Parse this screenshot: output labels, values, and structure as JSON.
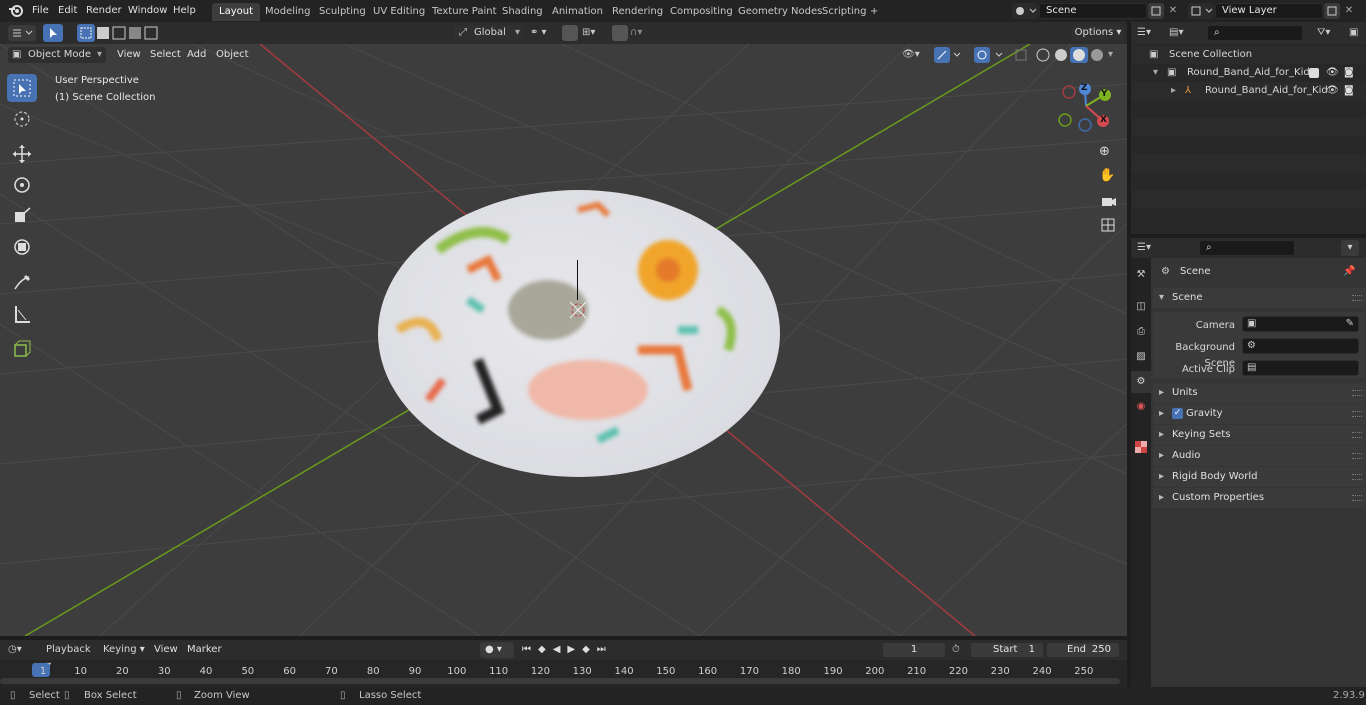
{
  "topbar": {
    "menus": [
      "File",
      "Edit",
      "Render",
      "Window",
      "Help"
    ],
    "workspaces": [
      "Layout",
      "Modeling",
      "Sculpting",
      "UV Editing",
      "Texture Paint",
      "Shading",
      "Animation",
      "Rendering",
      "Compositing",
      "Geometry Nodes",
      "Scripting"
    ],
    "add_tab": "+",
    "scene": "Scene",
    "view_layer": "View Layer"
  },
  "viewport_header": {
    "mode": "Object Mode",
    "menus": [
      "View",
      "Select",
      "Add",
      "Object"
    ],
    "orientation": "Global",
    "options": "Options"
  },
  "viewport": {
    "perspective": "User Perspective",
    "collection": "(1) Scene Collection",
    "axis_labels": {
      "x": "X",
      "y": "Y",
      "z": "Z"
    }
  },
  "outliner": {
    "root": "Scene Collection",
    "items": [
      {
        "label": "Round_Band_Aid_for_Kids"
      },
      {
        "label": "Round_Band_Aid_for_Kid"
      }
    ]
  },
  "properties": {
    "context": "Scene",
    "panel": "Scene",
    "fields": [
      {
        "label": "Camera",
        "value": ""
      },
      {
        "label": "Background Scene",
        "value": ""
      },
      {
        "label": "Active Clip",
        "value": ""
      }
    ],
    "sections": [
      "Units",
      "Gravity",
      "Keying Sets",
      "Audio",
      "Rigid Body World",
      "Custom Properties"
    ]
  },
  "timeline": {
    "menus": [
      "Playback",
      "Keying",
      "View",
      "Marker"
    ],
    "current_frame": "1",
    "start_label": "Start",
    "start": "1",
    "end_label": "End",
    "end": "250",
    "ruler": [
      "1",
      "10",
      "20",
      "30",
      "40",
      "50",
      "60",
      "70",
      "80",
      "90",
      "100",
      "110",
      "120",
      "130",
      "140",
      "150",
      "160",
      "170",
      "180",
      "190",
      "200",
      "210",
      "220",
      "230",
      "240",
      "250"
    ]
  },
  "status": {
    "select": "Select",
    "box_select": "Box Select",
    "zoom_view": "Zoom View",
    "lasso_select": "Lasso Select",
    "version": "2.93.9"
  },
  "colors": {
    "accent": "#4772b3",
    "x_axis": "#d54a4f",
    "y_axis": "#7fb321",
    "z_axis": "#4f88d6",
    "viewport": "#3d3d3d"
  }
}
